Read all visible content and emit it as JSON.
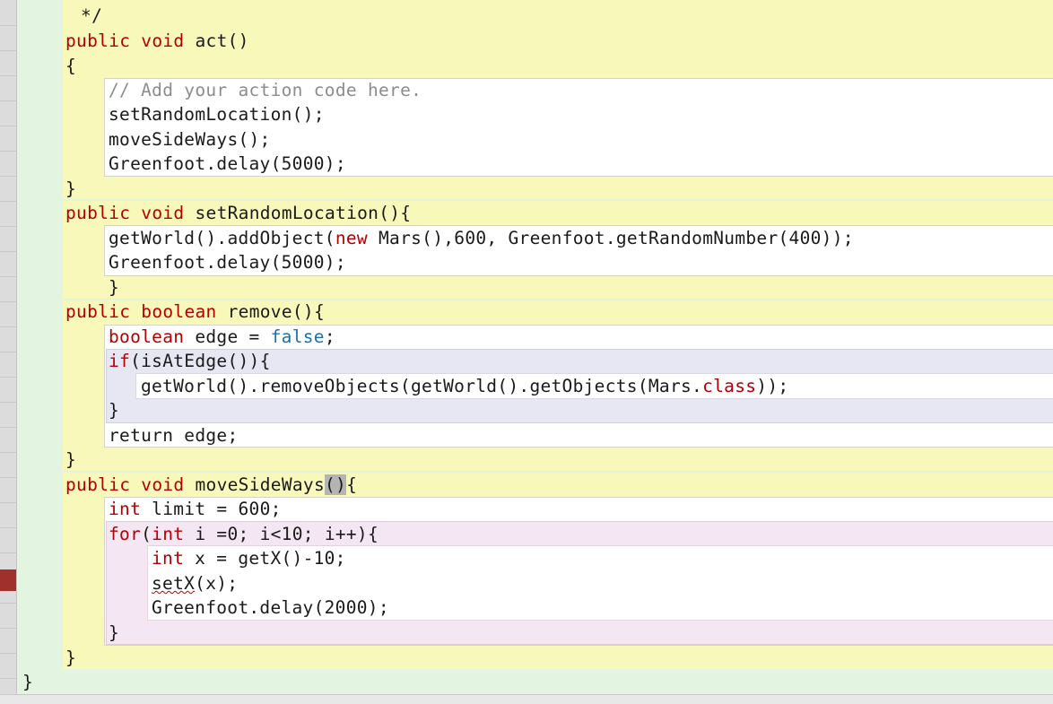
{
  "editor": {
    "lines": {
      "comment_end": " */",
      "act_kw1": "public",
      "act_kw2": "void",
      "act_name": "act()",
      "act_open": "{",
      "act_comment": "// Add your action code here.",
      "act_l1": "setRandomLocation();",
      "act_l2": "moveSideWays();",
      "act_l3": "Greenfoot.delay(5000);",
      "act_close": "}",
      "srl_kw1": "public",
      "srl_kw2": "void",
      "srl_name": "setRandomLocation(){",
      "srl_l1a": "getWorld().addObject(",
      "srl_l1kw": "new",
      "srl_l1b": " Mars(),600, Greenfoot.getRandomNumber(400));",
      "srl_l2": "Greenfoot.delay(5000);",
      "srl_close": "}",
      "rem_kw1": "public",
      "rem_kw2": "boolean",
      "rem_name": "remove(){",
      "rem_l1kw": "boolean",
      "rem_l1a": " edge = ",
      "rem_l1lit": "false",
      "rem_l1b": ";",
      "rem_if_kw": "if",
      "rem_if_rest": "(isAtEdge()){",
      "rem_if_body_a": "getWorld().removeObjects(getWorld().getObjects(Mars.",
      "rem_if_body_kw": "class",
      "rem_if_body_b": "));",
      "rem_if_close": "}",
      "rem_ret": "return edge;",
      "rem_close": "}",
      "msw_kw1": "public",
      "msw_kw2": "void",
      "msw_name": "moveSideWays",
      "msw_paren": "()",
      "msw_brace": "{",
      "msw_l1kw": "int",
      "msw_l1": " limit = 600;",
      "msw_for_kw": "for",
      "msw_for_a": "(",
      "msw_for_int": "int",
      "msw_for_b": " i =0; i<10; i++){",
      "msw_b1kw": "int",
      "msw_b1": " x = getX()-10;",
      "msw_b2a": "setX",
      "msw_b2b": "(x);",
      "msw_b3": "Greenfoot.delay(2000);",
      "msw_for_close": "}",
      "msw_close": "}",
      "class_close": "}"
    }
  }
}
